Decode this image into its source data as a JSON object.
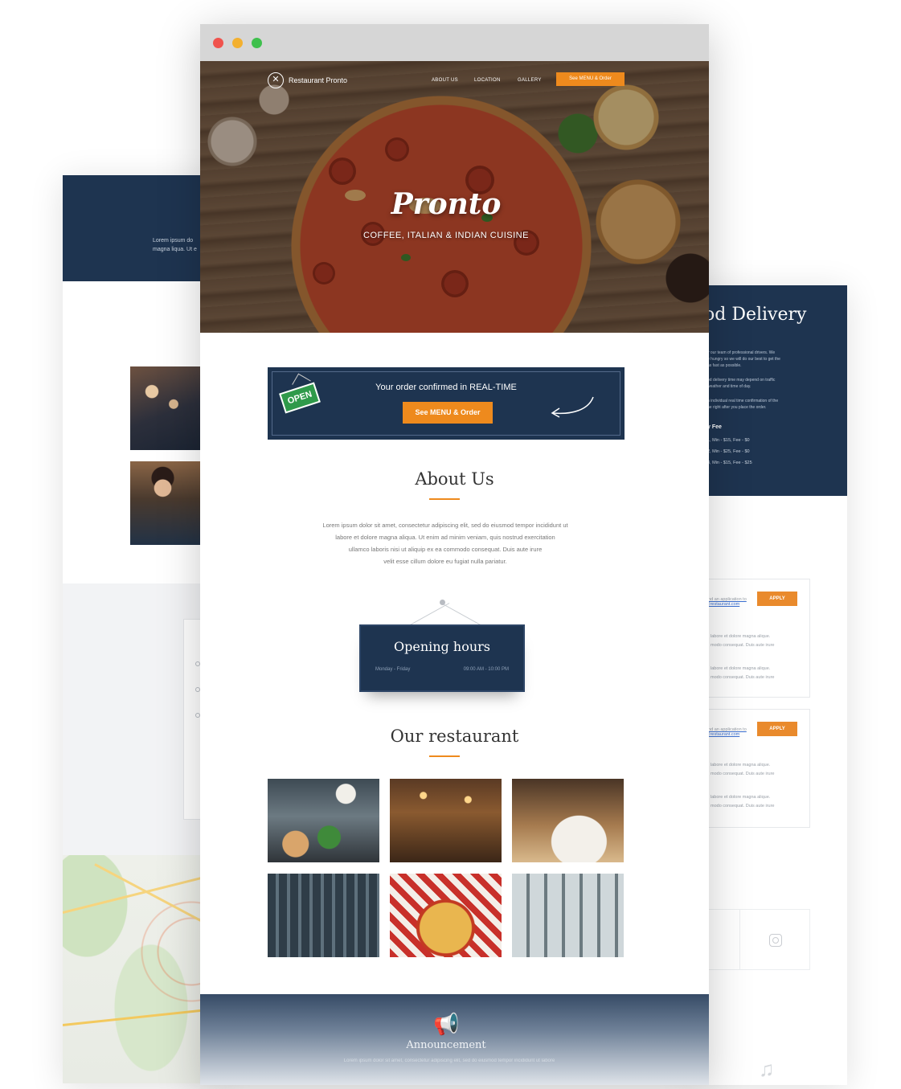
{
  "back_left": {
    "header_text_line1": "Lorem ipsum do",
    "header_text_line2": "magna liqua. Ut e"
  },
  "back_right": {
    "title": "od Delivery",
    "text_lines": [
      "y our team of professional drivers. We",
      "e hungry so we will do our best to get the",
      "as fast as possible.",
      "od delivery time may depend on traffic",
      "weather and time of day.",
      "n individual real time confirmation of the",
      "he right after you place the order."
    ],
    "fee_title": "y Fee",
    "fees": [
      "1, Min - $15, Fee - $0",
      "2, Min - $25, Fee - $0",
      "3, Min - $15, Fee - $25"
    ],
    "jobs": [
      {
        "email_line1": "end an application to",
        "email_line2": "@restaurant.com",
        "apply_label": "APPLY",
        "lines": [
          "labore et dolore magna alique.",
          "modo consequat. Duis aute irure",
          "labore et dolore magna alique.",
          "modo consequat. Duis aute irure"
        ]
      },
      {
        "email_line1": "end an application to",
        "email_line2": "@restaurant.com",
        "apply_label": "APPLY",
        "lines": [
          "labore et dolore magna alique.",
          "modo consequat. Duis aute irure",
          "labore et dolore magna alique.",
          "modo consequat. Duis aute irure"
        ]
      }
    ],
    "icons": [
      "instagram-icon",
      "music-note-icon"
    ]
  },
  "browser": {
    "window_controls": [
      "close",
      "minimize",
      "maximize"
    ],
    "nav": {
      "logo_icon": "fork-knife-icon",
      "logo_text": "Restaurant Pronto",
      "links": [
        "ABOUT US",
        "LOCATION",
        "GALLERY"
      ],
      "cta_label": "See MENU & Order"
    },
    "hero": {
      "title": "Pronto",
      "subtitle": "COFFEE, ITALIAN & INDIAN CUISINE"
    },
    "order_banner": {
      "sign_text": "OPEN",
      "text": "Your order confirmed in REAL-TIME",
      "button_label": "See MENU & Order"
    },
    "about": {
      "title": "About Us",
      "lines": [
        "Lorem ipsum dolor sit amet, consectetur adipiscing elit, sed do eiusmod tempor incididunt ut",
        "labore et dolore magna aliqua. Ut enim ad minim veniam, quis nostrud exercitation",
        "ullamco laboris nisi ut aliquip ex ea commodo consequat. Duis aute irure",
        "velit esse cillum dolore eu fugiat nulla pariatur."
      ]
    },
    "hours": {
      "title": "Opening hours",
      "days": "Monday - Friday",
      "time": "09:00 AM - 10:00 PM"
    },
    "restaurant": {
      "title": "Our restaurant",
      "photos": [
        "kitchen",
        "dining-room",
        "plated-dish",
        "bar",
        "pasta",
        "dining-hall"
      ]
    },
    "announcement": {
      "icon": "megaphone-icon",
      "title": "Announcement",
      "text": "Lorem ipsum dolor sit amet, consectetur adipiscing elit, sed do eiusmod tempor incididunt ut labore"
    }
  },
  "colors": {
    "navy": "#1e3450",
    "orange": "#ee8a1d",
    "open_green": "#2f9a4a"
  }
}
